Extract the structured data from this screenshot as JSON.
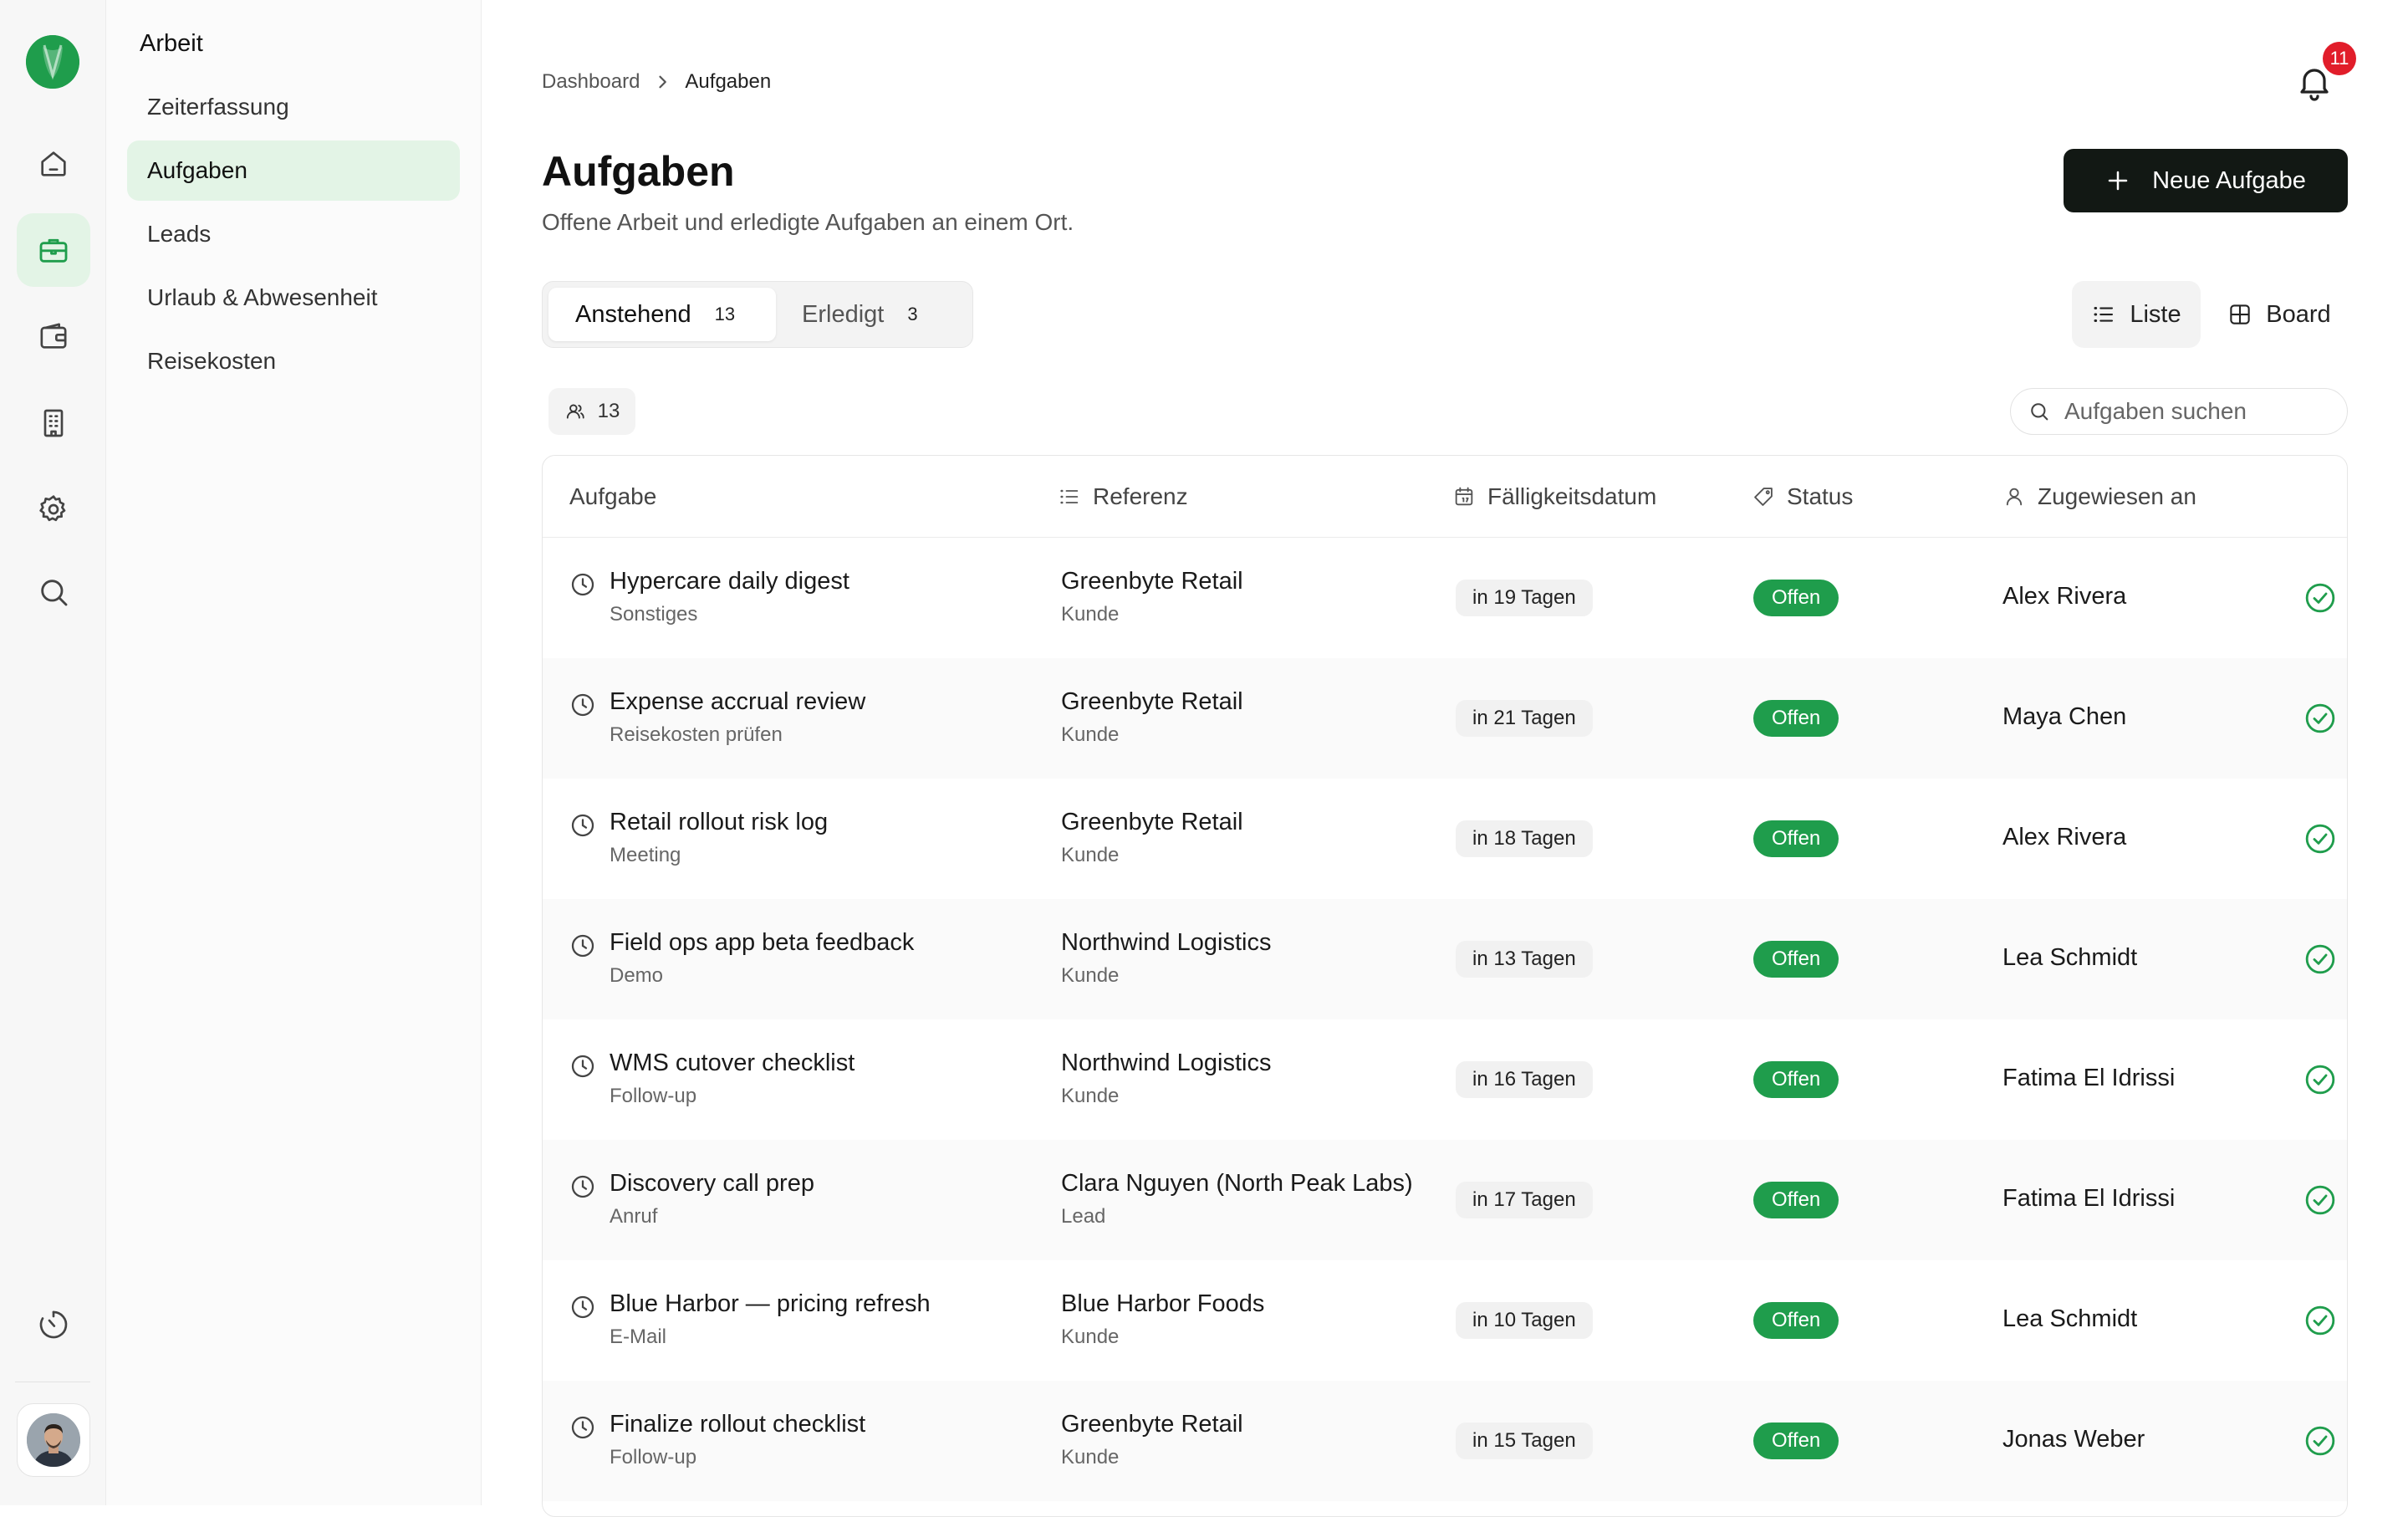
{
  "sidebar": {
    "section_title": "Arbeit",
    "items": [
      {
        "label": "Zeiterfassung",
        "active": false
      },
      {
        "label": "Aufgaben",
        "active": true
      },
      {
        "label": "Leads",
        "active": false
      },
      {
        "label": "Urlaub & Abwesenheit",
        "active": false
      },
      {
        "label": "Reisekosten",
        "active": false
      }
    ]
  },
  "rail": {
    "icons": [
      "home-icon",
      "briefcase-icon",
      "wallet-icon",
      "building-icon",
      "gear-icon",
      "search-icon",
      "timer-icon"
    ],
    "active": "briefcase-icon"
  },
  "header": {
    "breadcrumb": [
      "Dashboard",
      "Aufgaben"
    ],
    "notification_count": "11",
    "title": "Aufgaben",
    "subtitle": "Offene Arbeit und erledigte Aufgaben an einem Ort.",
    "new_button": "Neue Aufgabe"
  },
  "tabs": [
    {
      "label": "Anstehend",
      "count": "13",
      "active": true
    },
    {
      "label": "Erledigt",
      "count": "3",
      "active": false
    }
  ],
  "views": [
    {
      "label": "Liste",
      "active": true
    },
    {
      "label": "Board",
      "active": false
    }
  ],
  "filter": {
    "count": "13"
  },
  "search": {
    "placeholder": "Aufgaben suchen"
  },
  "table": {
    "columns": [
      "Aufgabe",
      "Referenz",
      "Fälligkeitsdatum",
      "Status",
      "Zugewiesen an"
    ],
    "rows": [
      {
        "title": "Hypercare daily digest",
        "type": "Sonstiges",
        "ref": "Greenbyte Retail",
        "ref_type": "Kunde",
        "due": "in 19 Tagen",
        "status": "Offen",
        "assignee": "Alex Rivera"
      },
      {
        "title": "Expense accrual review",
        "type": "Reisekosten prüfen",
        "ref": "Greenbyte Retail",
        "ref_type": "Kunde",
        "due": "in 21 Tagen",
        "status": "Offen",
        "assignee": "Maya Chen"
      },
      {
        "title": "Retail rollout risk log",
        "type": "Meeting",
        "ref": "Greenbyte Retail",
        "ref_type": "Kunde",
        "due": "in 18 Tagen",
        "status": "Offen",
        "assignee": "Alex Rivera"
      },
      {
        "title": "Field ops app beta feedback",
        "type": "Demo",
        "ref": "Northwind Logistics",
        "ref_type": "Kunde",
        "due": "in 13 Tagen",
        "status": "Offen",
        "assignee": "Lea Schmidt"
      },
      {
        "title": "WMS cutover checklist",
        "type": "Follow-up",
        "ref": "Northwind Logistics",
        "ref_type": "Kunde",
        "due": "in 16 Tagen",
        "status": "Offen",
        "assignee": "Fatima El Idrissi"
      },
      {
        "title": "Discovery call prep",
        "type": "Anruf",
        "ref": "Clara Nguyen (North Peak Labs)",
        "ref_type": "Lead",
        "due": "in 17 Tagen",
        "status": "Offen",
        "assignee": "Fatima El Idrissi"
      },
      {
        "title": "Blue Harbor — pricing refresh",
        "type": "E-Mail",
        "ref": "Blue Harbor Foods",
        "ref_type": "Kunde",
        "due": "in 10 Tagen",
        "status": "Offen",
        "assignee": "Lea Schmidt"
      },
      {
        "title": "Finalize rollout checklist",
        "type": "Follow-up",
        "ref": "Greenbyte Retail",
        "ref_type": "Kunde",
        "due": "in 15 Tagen",
        "status": "Offen",
        "assignee": "Jonas Weber"
      }
    ]
  },
  "colors": {
    "accent": "#1f9d4c",
    "accent_soft": "#e3f4e6",
    "badge": "#e11d2a",
    "primary_button": "#121814"
  }
}
